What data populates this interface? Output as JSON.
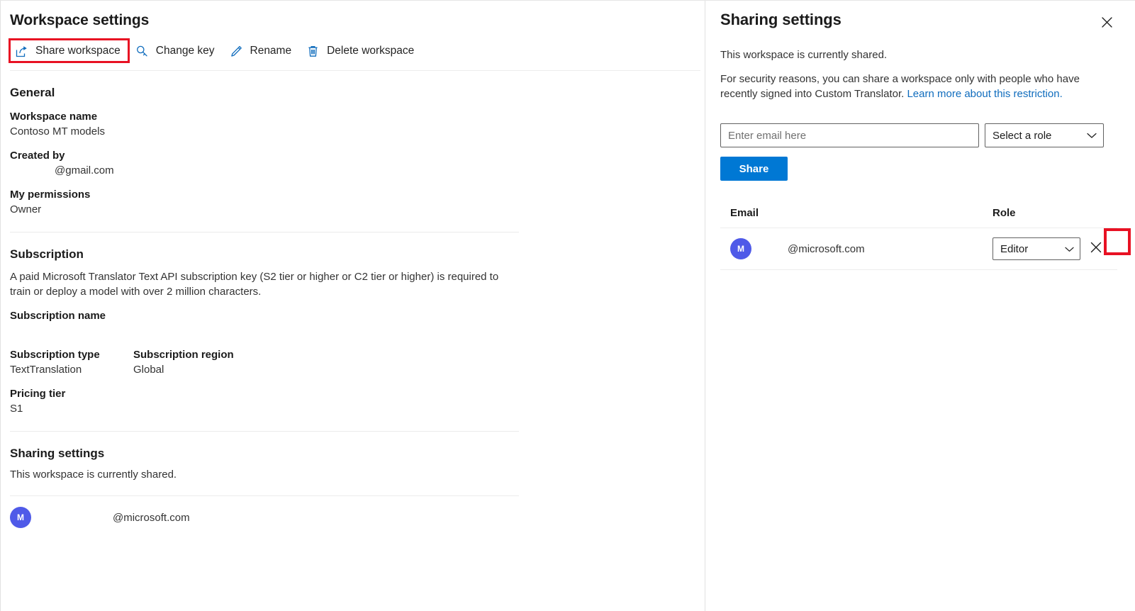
{
  "left": {
    "title": "Workspace settings",
    "toolbar": {
      "share_label": "Share workspace",
      "change_key_label": "Change key",
      "rename_label": "Rename",
      "delete_label": "Delete workspace",
      "highlight_color": "#e81123"
    },
    "general": {
      "heading": "General",
      "workspace_name_label": "Workspace name",
      "workspace_name_value": "Contoso MT models",
      "created_by_label": "Created by",
      "created_by_value": "@gmail.com",
      "permissions_label": "My permissions",
      "permissions_value": "Owner"
    },
    "subscription": {
      "heading": "Subscription",
      "description": "A paid Microsoft Translator Text API subscription key (S2 tier or higher or C2 tier or higher) is required to train or deploy a model with over 2 million characters.",
      "name_label": "Subscription name",
      "name_value": "",
      "type_label": "Subscription type",
      "type_value": "TextTranslation",
      "region_label": "Subscription region",
      "region_value": "Global",
      "pricing_tier_label": "Pricing tier",
      "pricing_tier_value": "S1"
    },
    "sharing": {
      "heading": "Sharing settings",
      "status": "This workspace is currently shared.",
      "member": {
        "avatar_initial": "M",
        "email": "@microsoft.com",
        "avatar_color": "#4f5ae8"
      }
    }
  },
  "right": {
    "title": "Sharing settings",
    "close_label": "Close",
    "status": "This workspace is currently shared.",
    "security_note_part1": "For security reasons, you can share a workspace only with people who have recently signed into Custom Translator. ",
    "security_note_link": "Learn more about this restriction.",
    "form": {
      "email_placeholder": "Enter email here",
      "email_value": "",
      "role_placeholder": "Select a role",
      "share_button_label": "Share",
      "share_button_color": "#0078d4"
    },
    "table": {
      "header_email": "Email",
      "header_role": "Role",
      "rows": [
        {
          "avatar_initial": "M",
          "avatar_color": "#4f5ae8",
          "email": "@microsoft.com",
          "role": "Editor",
          "remove_label": "Remove",
          "remove_highlighted": true
        }
      ]
    },
    "highlight_color": "#e81123"
  }
}
